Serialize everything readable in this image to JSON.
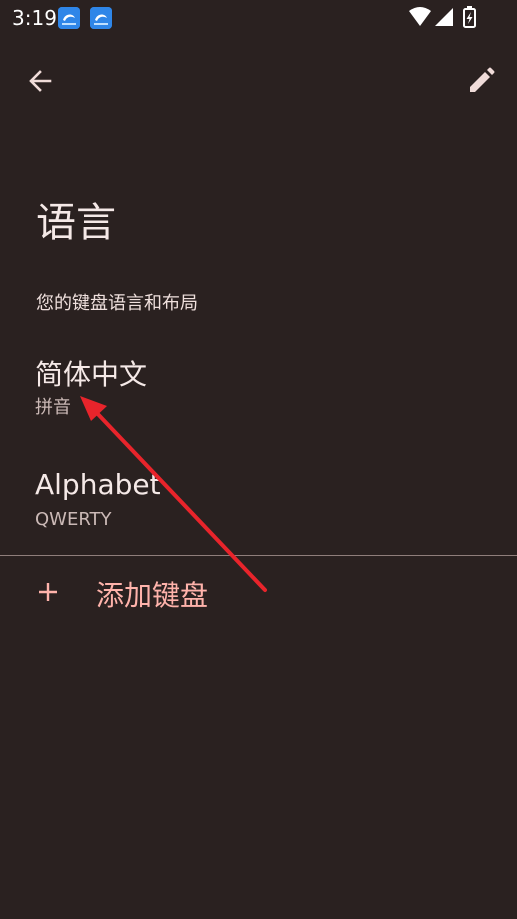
{
  "status_bar": {
    "time": "3:19",
    "notifications": [
      "app-notification-icon",
      "app-notification-icon"
    ],
    "indicators": [
      "wifi-icon",
      "signal-icon",
      "battery-charging-icon"
    ]
  },
  "app_bar": {
    "back_icon": "arrow-back-icon",
    "edit_icon": "pencil-icon"
  },
  "page": {
    "title": "语言",
    "subtitle": "您的键盘语言和布局"
  },
  "languages": [
    {
      "name": "简体中文",
      "layout": "拼音"
    },
    {
      "name": "Alphabet",
      "layout": "QWERTY"
    }
  ],
  "add_keyboard": {
    "icon": "plus-icon",
    "label": "添加键盘"
  },
  "colors": {
    "background": "#2A2120",
    "text_primary": "#F5E9E7",
    "text_secondary": "#CBB9B6",
    "accent": "#FFB3AB",
    "annotation_arrow": "#E8242B"
  }
}
